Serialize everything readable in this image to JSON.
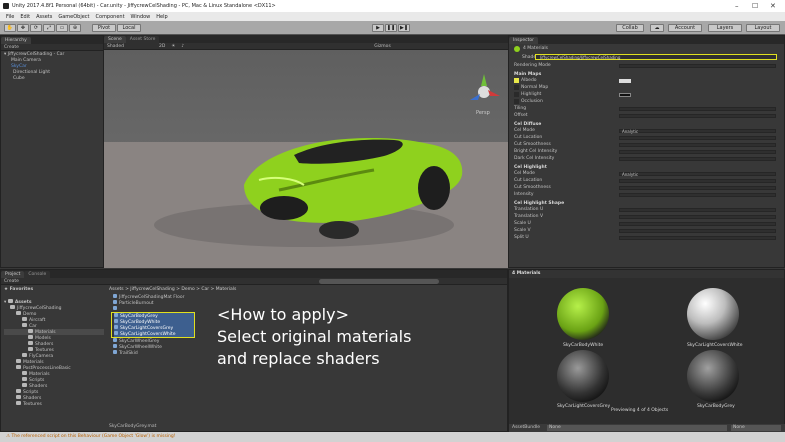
{
  "window": {
    "title": "Unity 2017.4.8f1 Personal (64bit) - Car.unity - JiffycrewCelShading - PC, Mac & Linux Standalone <DX11>"
  },
  "menu": [
    "File",
    "Edit",
    "Assets",
    "GameObject",
    "Component",
    "Window",
    "Help"
  ],
  "toolbar": {
    "pivot": "Pivot",
    "local": "Local",
    "collab": "Collab",
    "account": "Account",
    "layers": "Layers",
    "layout": "Layout"
  },
  "hierarchy": {
    "tab": "Hierarchy",
    "create": "Create",
    "scene": "JiffycrewCelShading - Car",
    "items": [
      "Main Camera",
      "SkyCar",
      "Directional Light",
      "Cube"
    ]
  },
  "scene": {
    "tab_scene": "Scene",
    "tab_store": "Asset Store",
    "shaded": "Shaded",
    "mode2d": "2D",
    "gizmos": "Gizmos",
    "persp": "Persp"
  },
  "inspector": {
    "tab": "Inspector",
    "materials_count": "4 Materials",
    "shader_label": "Shader",
    "shader_value": "JiffycrewCelShading/JiffycrewCelShading",
    "rendering_mode": "Rendering Mode",
    "main_maps": "Main Maps",
    "main_props": [
      "Albedo",
      "Normal Map",
      "Highlight",
      "Occlusion"
    ],
    "tiling": "Tiling",
    "offset": "Offset",
    "cel_diffuse": "Cel Diffuse",
    "cel_mode": "Cel Mode",
    "analytic": "Analytic",
    "diffuse_props": [
      "Cut Location",
      "Cut Smoothness",
      "Bright Cel Intensity",
      "Dark Cel Intensity"
    ],
    "cel_highlight": "Cel Highlight",
    "highlight_props": [
      "Cut Location",
      "Cut Smoothness",
      "Intensity"
    ],
    "cel_highlight_shape": "Cel Highlight Shape",
    "shape_props": [
      "Translation U",
      "Translation V",
      "Scale U",
      "Scale V",
      "Split U"
    ],
    "footer": "4 Materials"
  },
  "project": {
    "tab": "Project",
    "console_tab": "Console",
    "create": "Create",
    "favorites": "Favorites",
    "assets": "Assets",
    "breadcrumb": "Assets > JiffycrewCelShading > Demo > Car > Materials",
    "tree": [
      "JiffycrewCelShading",
      "Demo",
      "Aircraft",
      "Car",
      "Materials",
      "Models",
      "Shaders",
      "Textures",
      "FlyCamera",
      "Materials",
      "PostProcessLineBasic",
      "Materials",
      "Scripts",
      "Shaders",
      "Scripts",
      "Shaders",
      "Textures"
    ],
    "files": [
      "JiffycrewCelShadingMat Floor",
      "ParticleBurnout",
      "",
      "SkyCarBodyGrey",
      "SkyCarBodyWhite",
      "SkyCarLightCoversGrey",
      "SkyCarLightCoversWhite",
      "SkyCarWheelGrey",
      "SkyCarWheelWhite",
      "TrailSkid"
    ],
    "selected_file": "SkyCarBodyGrey.mat"
  },
  "caption": {
    "line1": "<How to apply>",
    "line2": "Select original materials",
    "line3": "and replace shaders"
  },
  "preview": {
    "labels": [
      "SkyCarBodyWhite",
      "SkyCarLightCoversWhite",
      "SkyCarLightCoversGrey",
      "SkyCarBodyGrey"
    ],
    "info": "Previewing 4 of 4 Objects",
    "assetbundle": "AssetBundle",
    "none1": "None",
    "none2": "None"
  },
  "status": {
    "message": "The referenced script on this Behaviour (Game Object 'Glow') is missing!"
  },
  "colors": {
    "highlight_box": "#e0e020",
    "car": "#8fd11e",
    "selection": "#5a8fd8"
  }
}
